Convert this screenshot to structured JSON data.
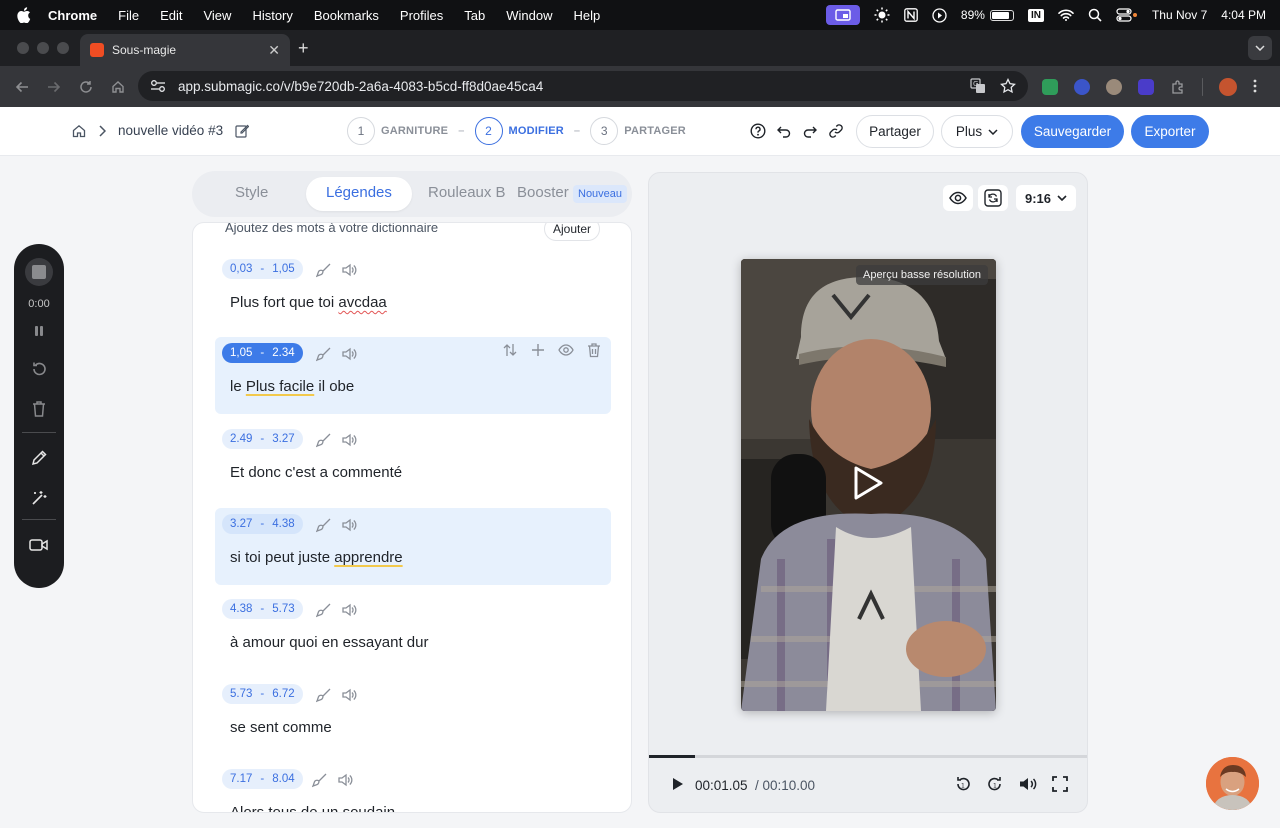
{
  "menubar": {
    "items": [
      "Chrome",
      "File",
      "Edit",
      "View",
      "History",
      "Bookmarks",
      "Profiles",
      "Tab",
      "Window",
      "Help"
    ],
    "battery": "89%",
    "date": "Thu Nov 7",
    "time": "4:04 PM",
    "badge": "IN"
  },
  "browser": {
    "tab_title": "Sous-magie",
    "url_host": "app.submagic.co",
    "url_path": "/v/b9e720db-2a6a-4083-b5cd-ff8d0ae45ca4"
  },
  "header": {
    "project_name": "nouvelle vidéo #3",
    "steps": [
      {
        "num": "1",
        "label": "GARNITURE"
      },
      {
        "num": "2",
        "label": "MODIFIER"
      },
      {
        "num": "3",
        "label": "PARTAGER"
      }
    ],
    "share_label": "Partager",
    "more_label": "Plus",
    "save_label": "Sauvegarder",
    "export_label": "Exporter"
  },
  "sidetools": {
    "time": "0:00"
  },
  "editor_tabs": {
    "style": "Style",
    "captions": "Légendes",
    "broll": "Rouleaux B",
    "booster": "Booster",
    "new_badge": "Nouveau"
  },
  "captions": {
    "dictionary_hint": "Ajoutez des mots à votre dictionnaire",
    "add_label": "Ajouter",
    "items": [
      {
        "start": "0,03",
        "end": "1,05",
        "text_a": "Plus fort que toi ",
        "text_b": "avcdaa",
        "text_c": ""
      },
      {
        "start": "1,05",
        "end": "2.34",
        "text_a": "le ",
        "text_b": "Plus facile",
        "text_c": " il obe"
      },
      {
        "start": "2.49",
        "end": "3.27",
        "text_a": "Et donc c'est a commenté",
        "text_b": "",
        "text_c": ""
      },
      {
        "start": "3.27",
        "end": "4.38",
        "text_a": "si toi peut juste ",
        "text_b": "apprendre",
        "text_c": ""
      },
      {
        "start": "4.38",
        "end": "5.73",
        "text_a": "à amour quoi en essayant dur",
        "text_b": "",
        "text_c": ""
      },
      {
        "start": "5.73",
        "end": "6.72",
        "text_a": "se sent comme",
        "text_b": "",
        "text_c": ""
      },
      {
        "start": "7.17",
        "end": "8.04",
        "text_a": "Alors tous de un soudain",
        "text_b": "",
        "text_c": ""
      }
    ]
  },
  "preview": {
    "aspect_ratio": "9:16",
    "lowres_label": "Aperçu basse résolution",
    "current_time": "00:01.05",
    "duration": "/ 00:10.00",
    "progress_fraction": 0.105
  },
  "colors": {
    "accent": "#3d7be8",
    "highlight": "#e7f1fd",
    "brand": "#f04d23"
  }
}
